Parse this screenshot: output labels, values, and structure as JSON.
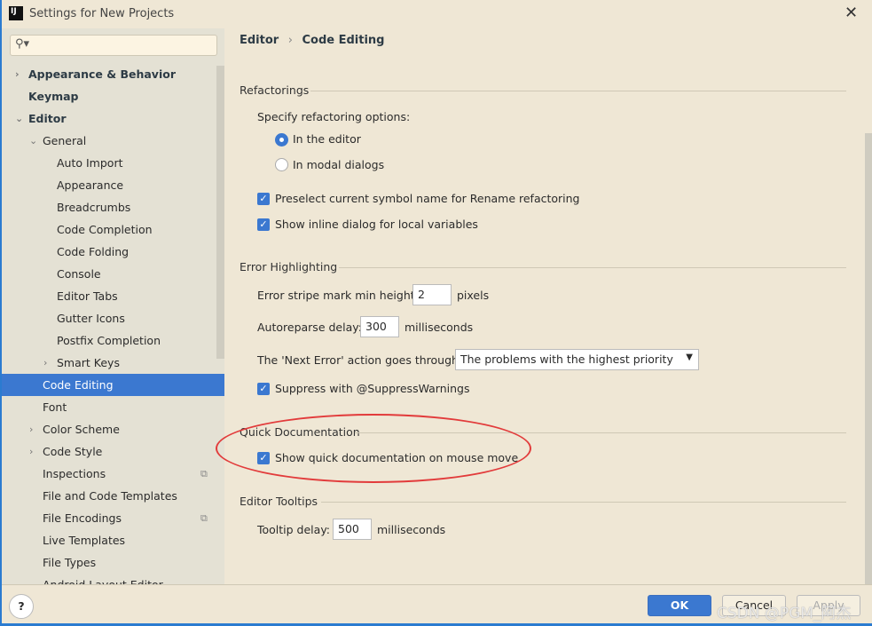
{
  "window": {
    "title": "Settings for New Projects",
    "logo": "IJ"
  },
  "sidebar": {
    "search_placeholder": "",
    "items": [
      {
        "label": "Appearance & Behavior",
        "level": 0,
        "arrow": "›",
        "bold": true
      },
      {
        "label": "Keymap",
        "level": 0,
        "bold": true
      },
      {
        "label": "Editor",
        "level": 0,
        "arrow": "⌄",
        "bold": true
      },
      {
        "label": "General",
        "level": 1,
        "arrow": "⌄"
      },
      {
        "label": "Auto Import",
        "level": 2
      },
      {
        "label": "Appearance",
        "level": 2
      },
      {
        "label": "Breadcrumbs",
        "level": 2
      },
      {
        "label": "Code Completion",
        "level": 2
      },
      {
        "label": "Code Folding",
        "level": 2
      },
      {
        "label": "Console",
        "level": 2
      },
      {
        "label": "Editor Tabs",
        "level": 2
      },
      {
        "label": "Gutter Icons",
        "level": 2
      },
      {
        "label": "Postfix Completion",
        "level": 2
      },
      {
        "label": "Smart Keys",
        "level": 2,
        "arrow": "›"
      },
      {
        "label": "Code Editing",
        "level": 1,
        "selected": true
      },
      {
        "label": "Font",
        "level": 1
      },
      {
        "label": "Color Scheme",
        "level": 1,
        "arrow": "›"
      },
      {
        "label": "Code Style",
        "level": 1,
        "arrow": "›"
      },
      {
        "label": "Inspections",
        "level": 1,
        "copy": true
      },
      {
        "label": "File and Code Templates",
        "level": 1
      },
      {
        "label": "File Encodings",
        "level": 1,
        "copy": true
      },
      {
        "label": "Live Templates",
        "level": 1
      },
      {
        "label": "File Types",
        "level": 1
      },
      {
        "label": "Android Layout Editor",
        "level": 1
      }
    ]
  },
  "breadcrumb": {
    "parent": "Editor",
    "sep": "›",
    "current": "Code Editing"
  },
  "refactorings": {
    "title": "Refactorings",
    "specify": "Specify refactoring options:",
    "radio1": "In the editor",
    "radio2": "In modal dialogs",
    "cb1": "Preselect current symbol name for Rename refactoring",
    "cb2": "Show inline dialog for local variables"
  },
  "error": {
    "title": "Error Highlighting",
    "stripe_label": "Error stripe mark min height:",
    "stripe_value": "2",
    "stripe_unit": "pixels",
    "reparse_label": "Autoreparse delay:",
    "reparse_value": "300",
    "reparse_unit": "milliseconds",
    "next_label": "The 'Next Error' action goes through:",
    "next_value": "The problems with the highest priority",
    "suppress": "Suppress with @SuppressWarnings"
  },
  "quickdoc": {
    "title": "Quick Documentation",
    "cb": "Show quick documentation on mouse move"
  },
  "tooltips": {
    "title": "Editor Tooltips",
    "delay_label": "Tooltip delay:",
    "delay_value": "500",
    "delay_unit": "milliseconds"
  },
  "footer": {
    "help": "?",
    "ok": "OK",
    "cancel": "Cancel",
    "apply": "Apply"
  },
  "watermark": "CSDN @PGM_阿杰",
  "colors": {
    "accent": "#3b78d0",
    "highlight": "#e23b3b"
  }
}
